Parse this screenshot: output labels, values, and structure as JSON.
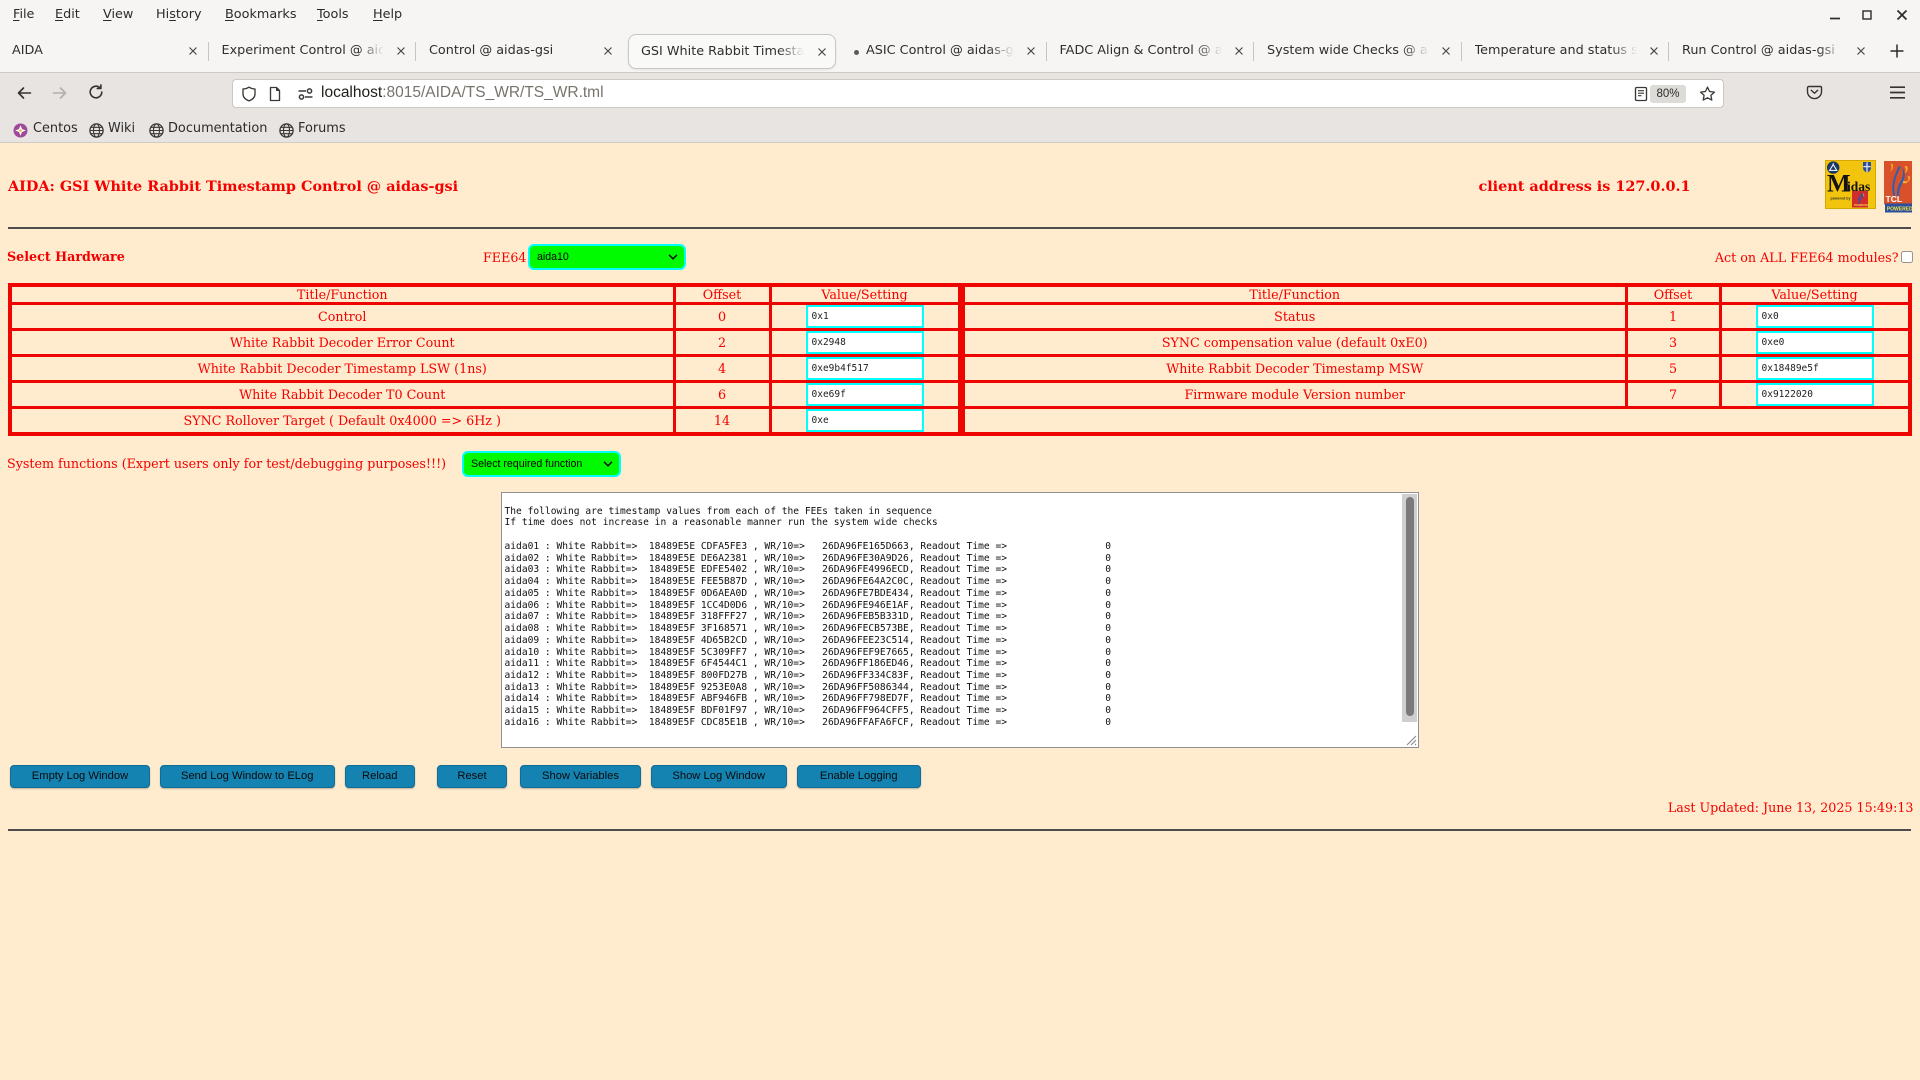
{
  "browser": {
    "menu": [
      {
        "pre": "",
        "u": "F",
        "post": "ile"
      },
      {
        "pre": "",
        "u": "E",
        "post": "dit"
      },
      {
        "pre": "",
        "u": "V",
        "post": "iew"
      },
      {
        "pre": "Hi",
        "u": "s",
        "post": "tory"
      },
      {
        "pre": "",
        "u": "B",
        "post": "ookmarks"
      },
      {
        "pre": "",
        "u": "T",
        "post": "ools"
      },
      {
        "pre": "",
        "u": "H",
        "post": "elp"
      }
    ],
    "tabs": [
      {
        "title": "AIDA",
        "active": false,
        "dot": false
      },
      {
        "title": "Experiment Control @ aidas-gsi",
        "active": false,
        "dot": false
      },
      {
        "title": "Control @ aidas-gsi",
        "active": false,
        "dot": false
      },
      {
        "title": "GSI White Rabbit Timestamp Control @ aidas-gsi",
        "active": true,
        "dot": false
      },
      {
        "title": "ASIC Control @ aidas-gsi",
        "active": false,
        "dot": true
      },
      {
        "title": "FADC Align & Control @ aidas-gsi",
        "active": false,
        "dot": false
      },
      {
        "title": "System wide Checks @ aidas-gsi",
        "active": false,
        "dot": false
      },
      {
        "title": "Temperature and status scan @ aidas-gsi",
        "active": false,
        "dot": false
      },
      {
        "title": "Run Control @ aidas-gsi",
        "active": false,
        "dot": false
      }
    ],
    "url_host": "localhost",
    "url_path": ":8015/AIDA/TS_WR/TS_WR.tml",
    "zoom_level": "80%",
    "bookmarks": [
      "Centos",
      "Wiki",
      "Documentation",
      "Forums"
    ]
  },
  "page": {
    "title": "AIDA: GSI White Rabbit Timestamp Control @ aidas-gsi",
    "client_address": "client address is 127.0.0.1",
    "select_hardware_label": "Select Hardware",
    "fee64_label": "FEE64",
    "fee64_value": "aida10",
    "act_on_all_label": "Act on ALL FEE64 modules?",
    "table_left": {
      "headers": [
        "Title/Function",
        "Offset",
        "Value/Setting"
      ],
      "rows": [
        {
          "title": "Control",
          "offset": "0",
          "value": "0x1"
        },
        {
          "title": "White Rabbit Decoder Error Count",
          "offset": "2",
          "value": "0x2948"
        },
        {
          "title": "White Rabbit Decoder Timestamp LSW (1ns)",
          "offset": "4",
          "value": "0xe9b4f517"
        },
        {
          "title": "White Rabbit Decoder T0 Count",
          "offset": "6",
          "value": "0xe69f"
        },
        {
          "title": "SYNC Rollover Target ( Default 0x4000 => 6Hz )",
          "offset": "14",
          "value": "0xe"
        }
      ]
    },
    "table_right": {
      "headers": [
        "Title/Function",
        "Offset",
        "Value/Setting"
      ],
      "rows": [
        {
          "title": "Status",
          "offset": "1",
          "value": "0x0"
        },
        {
          "title": "SYNC compensation value (default 0xE0)",
          "offset": "3",
          "value": "0xe0"
        },
        {
          "title": "White Rabbit Decoder Timestamp MSW",
          "offset": "5",
          "value": "0x18489e5f"
        },
        {
          "title": "Firmware module Version number",
          "offset": "7",
          "value": "0x9122020"
        }
      ]
    },
    "system_functions_label": "System functions (Expert users only for test/debugging purposes!!!)",
    "system_functions_value": "Select required function",
    "log_text": "\nThe following are timestamp values from each of the FEEs taken in sequence\nIf time does not increase in a reasonable manner run the system wide checks\n\naida01 : White Rabbit=>  18489E5E CDFA5FE3 , WR/10=>   26DA96FE165D663, Readout Time =>                 0\naida02 : White Rabbit=>  18489E5E DE6A2381 , WR/10=>   26DA96FE30A9D26, Readout Time =>                 0\naida03 : White Rabbit=>  18489E5E EDFE5402 , WR/10=>   26DA96FE4996ECD, Readout Time =>                 0\naida04 : White Rabbit=>  18489E5E FEE5B87D , WR/10=>   26DA96FE64A2C0C, Readout Time =>                 0\naida05 : White Rabbit=>  18489E5F 0D6AEA0D , WR/10=>   26DA96FE7BDE434, Readout Time =>                 0\naida06 : White Rabbit=>  18489E5F 1CC4D0D6 , WR/10=>   26DA96FE946E1AF, Readout Time =>                 0\naida07 : White Rabbit=>  18489E5F 318FFF27 , WR/10=>   26DA96FEB5B331D, Readout Time =>                 0\naida08 : White Rabbit=>  18489E5F 3F168571 , WR/10=>   26DA96FECB573BE, Readout Time =>                 0\naida09 : White Rabbit=>  18489E5F 4D65B2CD , WR/10=>   26DA96FEE23C514, Readout Time =>                 0\naida10 : White Rabbit=>  18489E5F 5C309FF7 , WR/10=>   26DA96FEF9E7665, Readout Time =>                 0\naida11 : White Rabbit=>  18489E5F 6F4544C1 , WR/10=>   26DA96FF186ED46, Readout Time =>                 0\naida12 : White Rabbit=>  18489E5F 800FD27B , WR/10=>   26DA96FF334C83F, Readout Time =>                 0\naida13 : White Rabbit=>  18489E5F 9253E0A8 , WR/10=>   26DA96FF5086344, Readout Time =>                 0\naida14 : White Rabbit=>  18489E5F ABF946FB , WR/10=>   26DA96FF798ED7F, Readout Time =>                 0\naida15 : White Rabbit=>  18489E5F BDF01F97 , WR/10=>   26DA96FF964CFF5, Readout Time =>                 0\naida16 : White Rabbit=>  18489E5F CDC85E1B , WR/10=>   26DA96FFAFA6FCF, Readout Time =>                 0",
    "buttons": [
      "Empty Log Window",
      "Send Log Window to ELog",
      "Reload",
      "Reset",
      "Show Variables",
      "Show Log Window",
      "Enable Logging"
    ],
    "last_updated": "Last Updated: June 13, 2025 15:49:13",
    "colors": {
      "page_background": "#ffebcd",
      "accent_red": "#f40000",
      "select_green": "#00fb00",
      "input_border_cyan": "#00ffff",
      "button_blue": "#1583b2"
    }
  }
}
